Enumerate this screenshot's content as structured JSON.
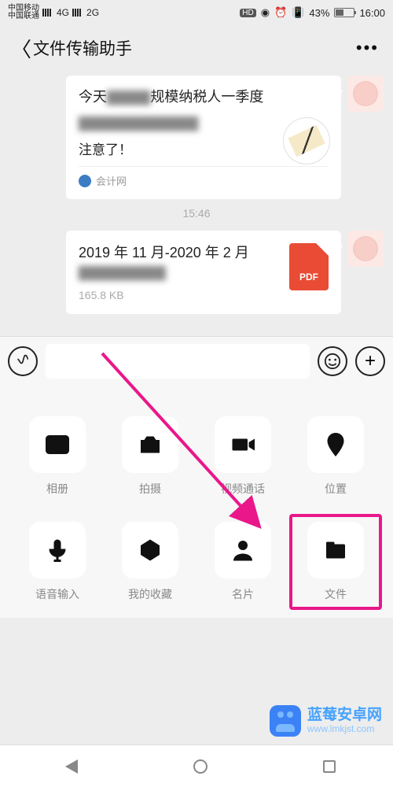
{
  "status": {
    "carrier1": "中国移动",
    "carrier2": "中国联通",
    "net1": "4G",
    "net2": "2G",
    "hd": "HD",
    "battery_pct": "43%",
    "time": "16:00"
  },
  "header": {
    "title": "文件传输助手"
  },
  "chat": {
    "article": {
      "line1_prefix": "今天",
      "line1_blurred": "▇▇▇▇",
      "line1_suffix": "规模纳税人一季度",
      "line2_blurred": "▇▇▇▇▇▇▇▇▇▇▇",
      "line3": "注意了！",
      "source": "会计网"
    },
    "time_separator": "15:46",
    "file": {
      "name_line1": "2019 年 11 月-2020 年 2 月",
      "name_line2_blurred": "▇▇▇▇▇▇▇▇",
      "size": "165.8 KB",
      "badge": "PDF"
    }
  },
  "attach": {
    "items": [
      {
        "label": "相册",
        "icon": "gallery-icon"
      },
      {
        "label": "拍摄",
        "icon": "camera-icon"
      },
      {
        "label": "视频通话",
        "icon": "video-icon"
      },
      {
        "label": "位置",
        "icon": "location-icon"
      },
      {
        "label": "语音输入",
        "icon": "mic-icon"
      },
      {
        "label": "我的收藏",
        "icon": "favorite-icon"
      },
      {
        "label": "名片",
        "icon": "contact-icon"
      },
      {
        "label": "文件",
        "icon": "file-icon"
      }
    ]
  },
  "watermark": {
    "name": "蓝莓安卓网",
    "url": "www.lmkjst.com"
  }
}
